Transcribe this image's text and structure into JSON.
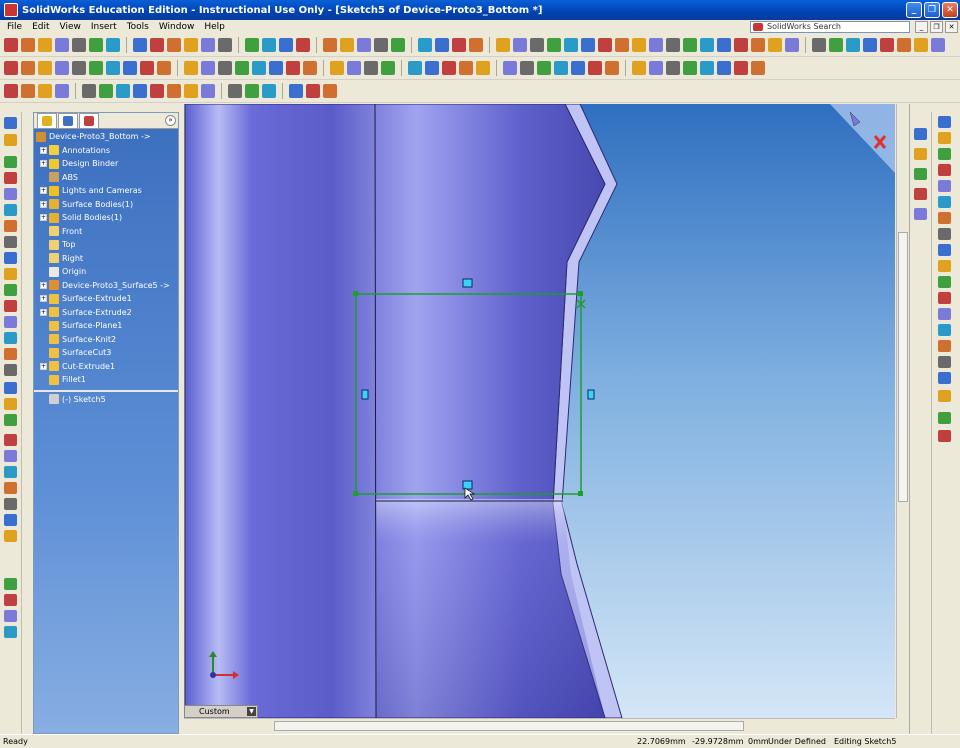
{
  "window": {
    "title": "SolidWorks Education Edition - Instructional Use Only - [Sketch5 of Device-Proto3_Bottom *]",
    "minimize_label": "_",
    "restore_label": "❐",
    "close_label": "✕"
  },
  "menu": [
    "File",
    "Edit",
    "View",
    "Insert",
    "Tools",
    "Window",
    "Help"
  ],
  "search": {
    "placeholder": "SolidWorks Search"
  },
  "feature_tree": {
    "collapse_label": "»",
    "root": "Device-Proto3_Bottom ->",
    "items": [
      {
        "label": "Annotations",
        "expandable": true,
        "icon": "annotations-icon",
        "color": "#f0d040"
      },
      {
        "label": "Design Binder",
        "expandable": true,
        "icon": "design-binder-icon",
        "color": "#f0c830"
      },
      {
        "label": "ABS",
        "expandable": false,
        "icon": "material-icon",
        "color": "#c8a060"
      },
      {
        "label": "Lights and Cameras",
        "expandable": true,
        "icon": "lights-icon",
        "color": "#f0c020"
      },
      {
        "label": "Surface Bodies(1)",
        "expandable": true,
        "icon": "surface-bodies-icon",
        "color": "#e8b030"
      },
      {
        "label": "Solid Bodies(1)",
        "expandable": true,
        "icon": "solid-bodies-icon",
        "color": "#e8b030"
      },
      {
        "label": "Front",
        "expandable": false,
        "icon": "plane-icon",
        "color": "#f0d070"
      },
      {
        "label": "Top",
        "expandable": false,
        "icon": "plane-icon",
        "color": "#f0d070"
      },
      {
        "label": "Right",
        "expandable": false,
        "icon": "plane-icon",
        "color": "#f0d070"
      },
      {
        "label": "Origin",
        "expandable": false,
        "icon": "origin-icon",
        "color": "#e8e8e8"
      },
      {
        "label": "Device-Proto3_Surface5 ->",
        "expandable": true,
        "icon": "derived-part-icon",
        "color": "#e09030"
      },
      {
        "label": "Surface-Extrude1",
        "expandable": true,
        "icon": "surface-extrude-icon",
        "color": "#f0c040"
      },
      {
        "label": "Surface-Extrude2",
        "expandable": true,
        "icon": "surface-extrude-icon",
        "color": "#f0c040"
      },
      {
        "label": "Surface-Plane1",
        "expandable": false,
        "icon": "surface-plane-icon",
        "color": "#f0c040"
      },
      {
        "label": "Surface-Knit2",
        "expandable": false,
        "icon": "surface-knit-icon",
        "color": "#f0c040"
      },
      {
        "label": "SurfaceCut3",
        "expandable": false,
        "icon": "surface-cut-icon",
        "color": "#f0c040"
      },
      {
        "label": "Cut-Extrude1",
        "expandable": true,
        "icon": "cut-extrude-icon",
        "color": "#f0c040"
      },
      {
        "label": "Fillet1",
        "expandable": false,
        "icon": "fillet-icon",
        "color": "#f0c040"
      }
    ],
    "after_rollback": {
      "label": "(-) Sketch5",
      "icon": "sketch-icon",
      "color": "#d0d0d0"
    }
  },
  "view_selector": {
    "value": "Custom"
  },
  "status": {
    "left": "Ready",
    "x": "22.7069mm",
    "y": "-29.9728mm",
    "z": "0mm",
    "state": "Under Defined",
    "editing": "Editing Sketch5"
  },
  "colors": {
    "sketch_green": "#1e9e2a",
    "handle_cyan": "#33d6f5",
    "body_blue": "#6f6fd8",
    "confirm_red": "#e03030"
  }
}
